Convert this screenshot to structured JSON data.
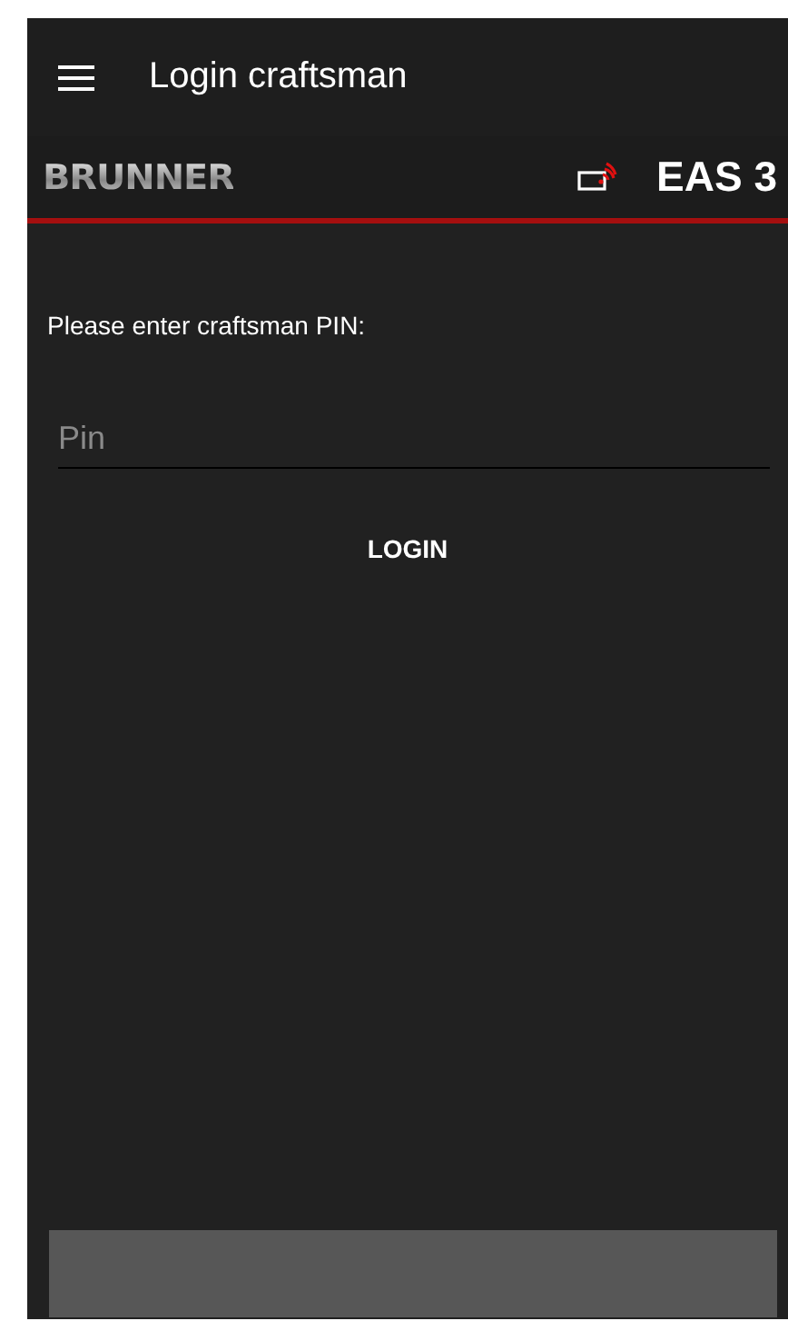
{
  "app_bar": {
    "title": "Login craftsman"
  },
  "brand_bar": {
    "logo": "BRUNNER",
    "device": "EAS 3"
  },
  "form": {
    "prompt": "Please enter craftsman PIN:",
    "pin_field": {
      "placeholder": "Pin"
    },
    "login_button": "LOGIN"
  }
}
